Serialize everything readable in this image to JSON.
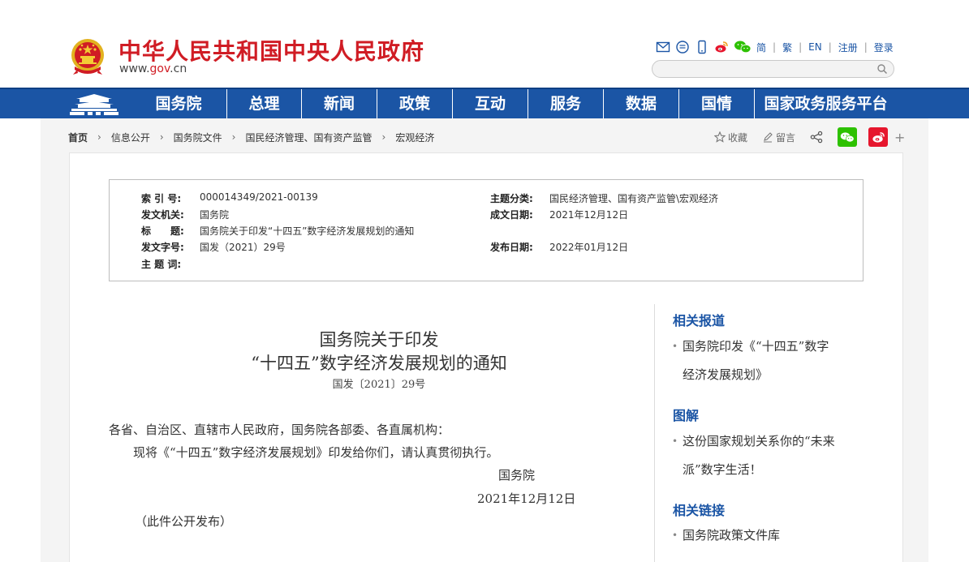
{
  "header": {
    "site_title": "中华人民共和国中央人民政府",
    "site_url_prefix": "www.",
    "site_url_gov": "gov",
    "site_url_suffix": ".cn",
    "tools": [
      "简",
      "繁",
      "EN",
      "注册",
      "登录"
    ],
    "tool_icons": [
      "mail-icon",
      "chat-icon",
      "mobile-icon",
      "weibo-icon",
      "wechat-icon"
    ],
    "search_placeholder": ""
  },
  "nav": {
    "items": [
      "国务院",
      "总理",
      "新闻",
      "政策",
      "互动",
      "服务",
      "数据",
      "国情",
      "国家政务服务平台"
    ]
  },
  "breadcrumb": [
    "首页",
    "信息公开",
    "国务院文件",
    "国民经济管理、国有资产监管",
    "宏观经济"
  ],
  "share": {
    "favorite": "收藏",
    "comment": "留言"
  },
  "meta": {
    "index_label": "索 引 号:",
    "index_value": "000014349/2021-00139",
    "topic_label": "主题分类:",
    "topic_value": "国民经济管理、国有资产监管\\宏观经济",
    "issuer_label": "发文机关:",
    "issuer_value": "国务院",
    "date_written_label": "成文日期:",
    "date_written_value": "2021年12月12日",
    "title_label": "标　　题:",
    "title_value": "国务院关于印发“十四五”数字经济发展规划的通知",
    "docno_label": "发文字号:",
    "docno_value": "国发（2021）29号",
    "pubdate_label": "发布日期:",
    "pubdate_value": "2022年01月12日",
    "keywords_label": "主 题 词:",
    "keywords_value": ""
  },
  "article": {
    "title_line1": "国务院关于印发",
    "title_line2": "“十四五”数字经济发展规划的通知",
    "doc_number": "国发〔2021〕29号",
    "recipients": "各省、自治区、直辖市人民政府，国务院各部委、各直属机构：",
    "body": "现将《“十四五”数字经济发展规划》印发给你们，请认真贯彻执行。",
    "signature": "国务院",
    "date": "2021年12月12日",
    "note": "（此件公开发布）"
  },
  "sidebar": {
    "related_reports_title": "相关报道",
    "related_reports_item_l1": "国务院印发《“十四五”数字",
    "related_reports_item_l2": "经济发展规划》",
    "graphic_title": "图解",
    "graphic_item_l1": "这份国家规划关系你的“未来",
    "graphic_item_l2": "派”数字生活！",
    "links_title": "相关链接",
    "links_item": "国务院政策文件库"
  },
  "colors": {
    "brand_red": "#d01c24",
    "nav_blue": "#1b55a5",
    "wechat_green": "#2dc100",
    "weibo_red": "#e6162d"
  }
}
